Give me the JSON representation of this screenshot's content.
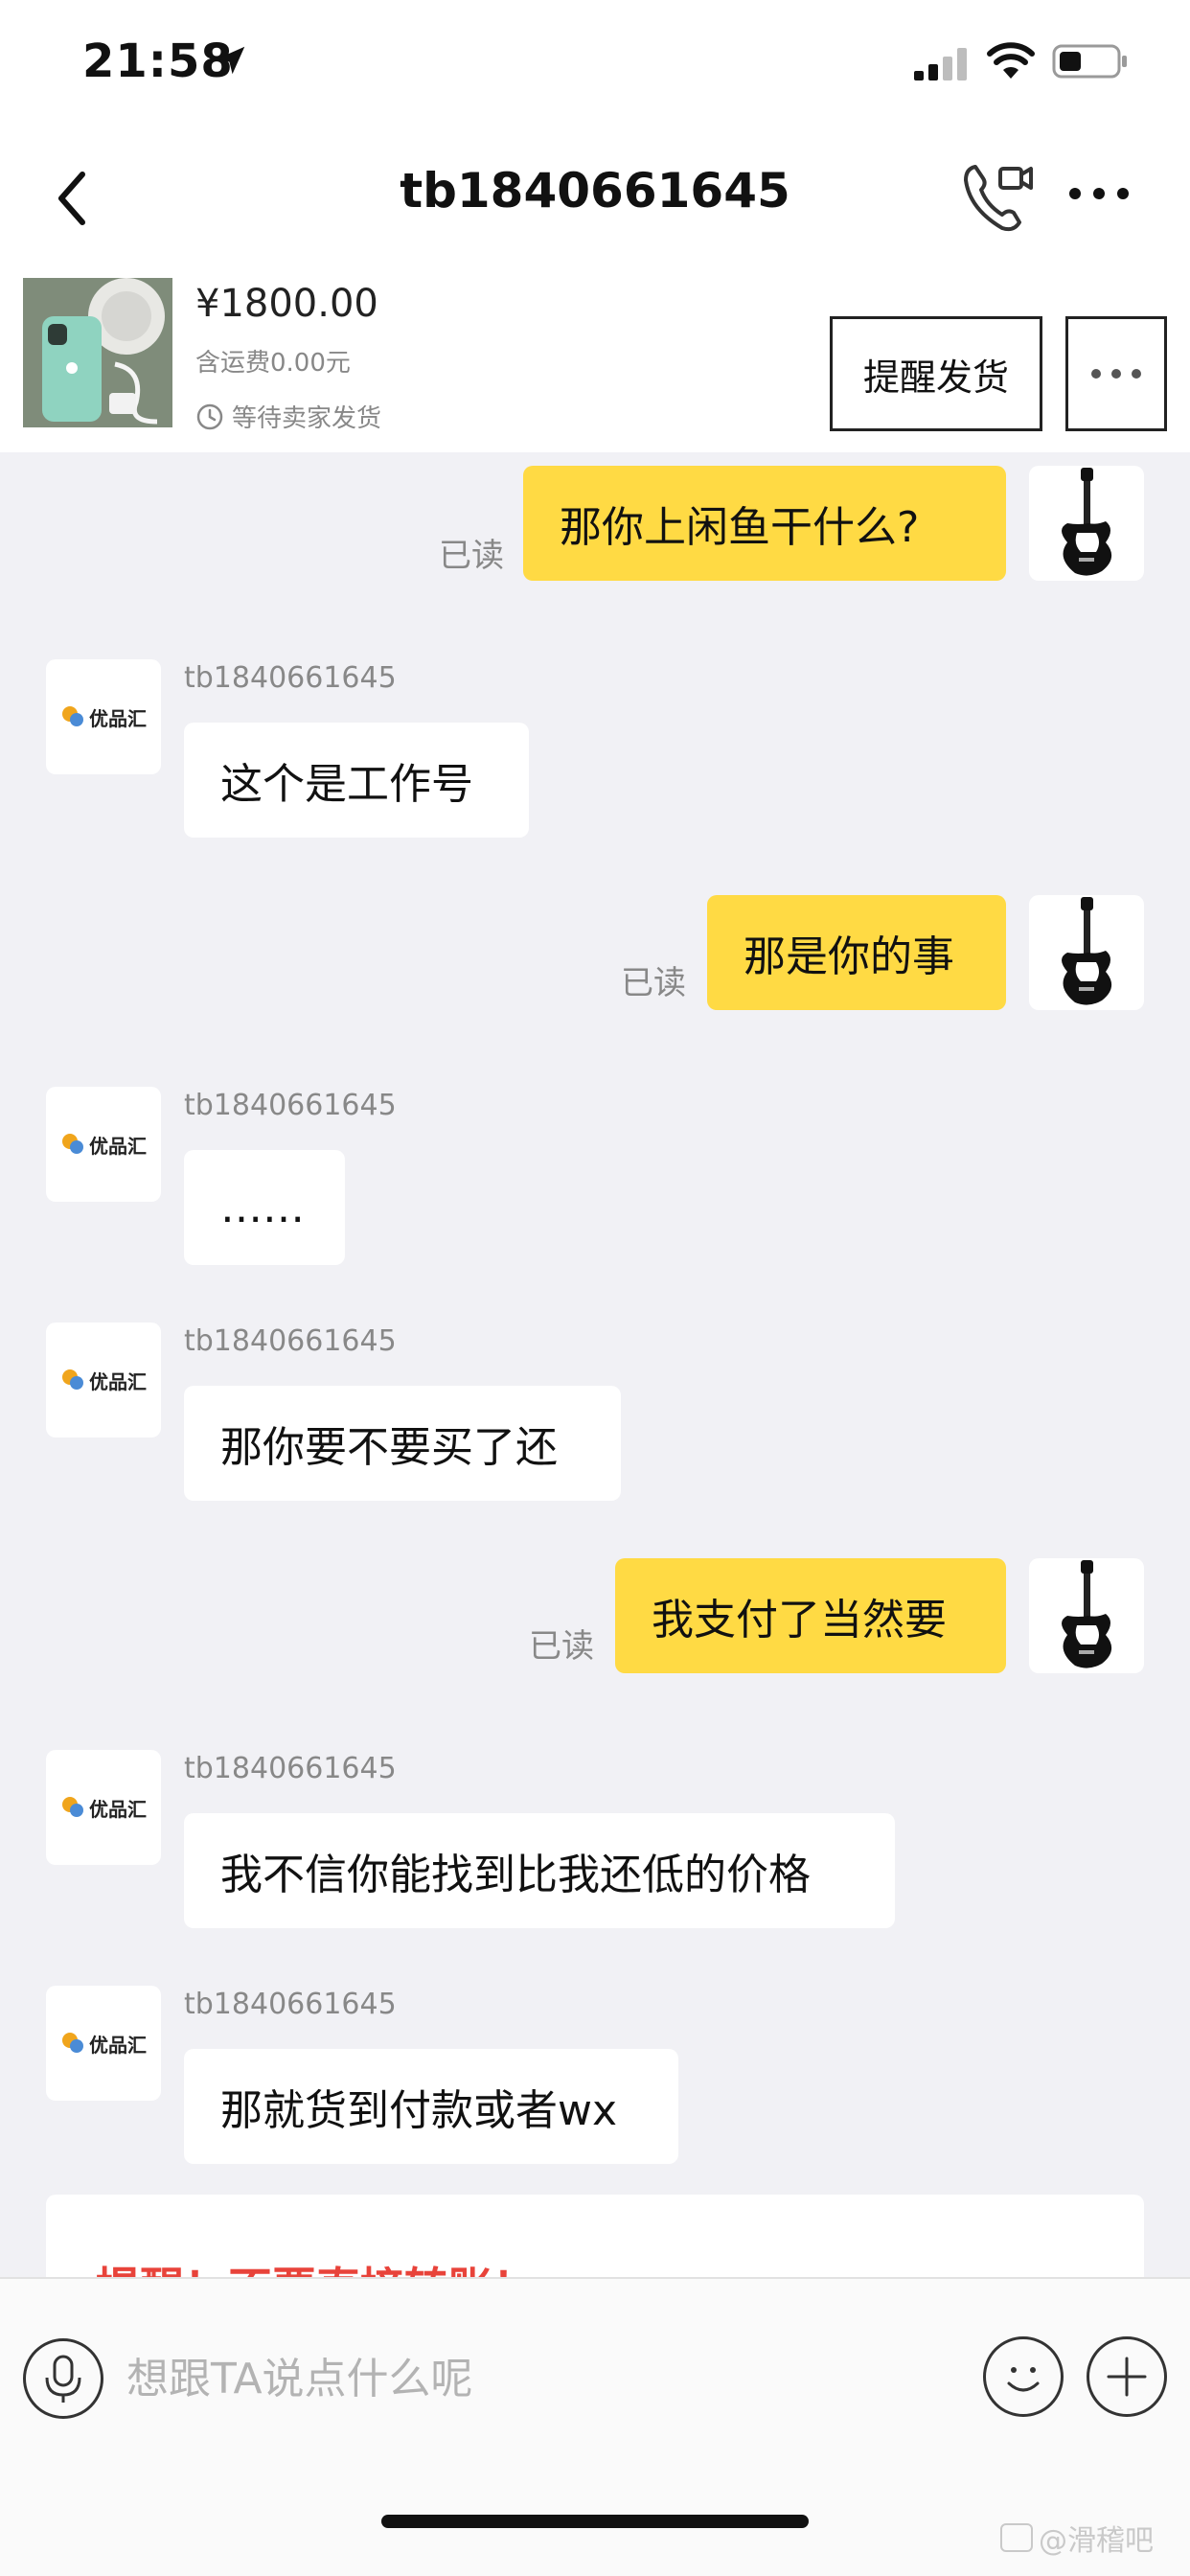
{
  "status_bar": {
    "time": "21:58",
    "icons": [
      "location-arrow-icon",
      "signal-icon",
      "wifi-icon",
      "battery-icon"
    ]
  },
  "header": {
    "title": "tb1840661645",
    "icons": [
      "back-icon",
      "phone-video-icon",
      "more-icon"
    ]
  },
  "product": {
    "price": "¥1800.00",
    "shipping": "含运费0.00元",
    "status": "等待卖家发货",
    "remind_button": "提醒发货",
    "accent": "#ffda44"
  },
  "messages": [
    {
      "from": "me",
      "text": "那你上闲鱼干什么?",
      "status": "已读"
    },
    {
      "from": "them",
      "sender": "tb1840661645",
      "text": "这个是工作号"
    },
    {
      "from": "me",
      "text": "那是你的事",
      "status": "已读"
    },
    {
      "from": "them",
      "sender": "tb1840661645",
      "text": "……"
    },
    {
      "from": "them",
      "sender": "tb1840661645",
      "text": "那你要不要买了还"
    },
    {
      "from": "me",
      "text": "我支付了当然要",
      "status": "已读"
    },
    {
      "from": "them",
      "sender": "tb1840661645",
      "text": "我不信你能找到比我还低的价格"
    },
    {
      "from": "them",
      "sender": "tb1840661645",
      "text": "那就货到付款或者wx"
    }
  ],
  "avatars": {
    "them_logo_text": "优品汇"
  },
  "warning": {
    "text": "提醒！不要直接转账！",
    "color": "#e8433a"
  },
  "input": {
    "placeholder": "想跟TA说点什么呢",
    "value": ""
  },
  "watermark": "@滑稽吧"
}
